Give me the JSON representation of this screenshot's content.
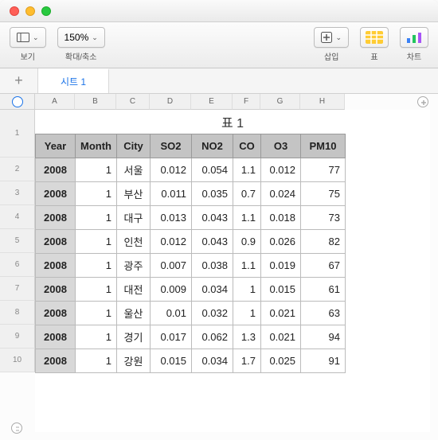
{
  "toolbar": {
    "view_label": "보기",
    "zoom_value": "150%",
    "zoom_label": "확대/축소",
    "insert_label": "삽입",
    "table_label": "표",
    "chart_label": "차트"
  },
  "tabs": {
    "sheet1": "시트 1"
  },
  "columns_letters": [
    "A",
    "B",
    "C",
    "D",
    "E",
    "F",
    "G",
    "H"
  ],
  "table": {
    "title": "표 1",
    "headers": [
      "Year",
      "Month",
      "City",
      "SO2",
      "NO2",
      "CO",
      "O3",
      "PM10"
    ],
    "rows": [
      {
        "year": "2008",
        "month": "1",
        "city": "서울",
        "so2": "0.012",
        "no2": "0.054",
        "co": "1.1",
        "o3": "0.012",
        "pm10": "77"
      },
      {
        "year": "2008",
        "month": "1",
        "city": "부산",
        "so2": "0.011",
        "no2": "0.035",
        "co": "0.7",
        "o3": "0.024",
        "pm10": "75"
      },
      {
        "year": "2008",
        "month": "1",
        "city": "대구",
        "so2": "0.013",
        "no2": "0.043",
        "co": "1.1",
        "o3": "0.018",
        "pm10": "73"
      },
      {
        "year": "2008",
        "month": "1",
        "city": "인천",
        "so2": "0.012",
        "no2": "0.043",
        "co": "0.9",
        "o3": "0.026",
        "pm10": "82"
      },
      {
        "year": "2008",
        "month": "1",
        "city": "광주",
        "so2": "0.007",
        "no2": "0.038",
        "co": "1.1",
        "o3": "0.019",
        "pm10": "67"
      },
      {
        "year": "2008",
        "month": "1",
        "city": "대전",
        "so2": "0.009",
        "no2": "0.034",
        "co": "1",
        "o3": "0.015",
        "pm10": "61"
      },
      {
        "year": "2008",
        "month": "1",
        "city": "울산",
        "so2": "0.01",
        "no2": "0.032",
        "co": "1",
        "o3": "0.021",
        "pm10": "63"
      },
      {
        "year": "2008",
        "month": "1",
        "city": "경기",
        "so2": "0.017",
        "no2": "0.062",
        "co": "1.3",
        "o3": "0.021",
        "pm10": "94"
      },
      {
        "year": "2008",
        "month": "1",
        "city": "강원",
        "so2": "0.015",
        "no2": "0.034",
        "co": "1.7",
        "o3": "0.025",
        "pm10": "91"
      }
    ]
  },
  "chart_data": {
    "type": "table",
    "title": "표 1",
    "columns": [
      "Year",
      "Month",
      "City",
      "SO2",
      "NO2",
      "CO",
      "O3",
      "PM10"
    ],
    "data": [
      [
        2008,
        1,
        "서울",
        0.012,
        0.054,
        1.1,
        0.012,
        77
      ],
      [
        2008,
        1,
        "부산",
        0.011,
        0.035,
        0.7,
        0.024,
        75
      ],
      [
        2008,
        1,
        "대구",
        0.013,
        0.043,
        1.1,
        0.018,
        73
      ],
      [
        2008,
        1,
        "인천",
        0.012,
        0.043,
        0.9,
        0.026,
        82
      ],
      [
        2008,
        1,
        "광주",
        0.007,
        0.038,
        1.1,
        0.019,
        67
      ],
      [
        2008,
        1,
        "대전",
        0.009,
        0.034,
        1.0,
        0.015,
        61
      ],
      [
        2008,
        1,
        "울산",
        0.01,
        0.032,
        1.0,
        0.021,
        63
      ],
      [
        2008,
        1,
        "경기",
        0.017,
        0.062,
        1.3,
        0.021,
        94
      ],
      [
        2008,
        1,
        "강원",
        0.015,
        0.034,
        1.7,
        0.025,
        91
      ]
    ]
  }
}
